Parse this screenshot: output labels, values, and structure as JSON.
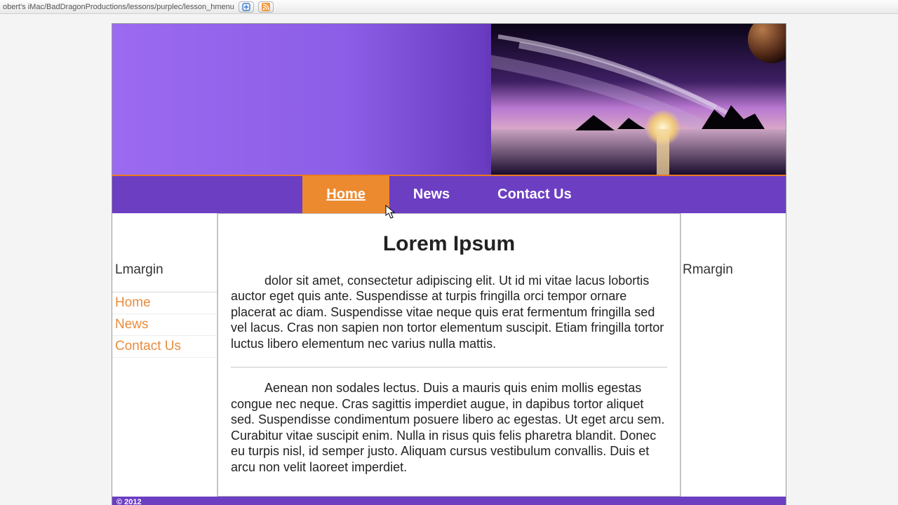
{
  "browser": {
    "path": "obert's iMac/BadDragonProductions/lessons/purplec/lesson_hmenu"
  },
  "nav": {
    "items": [
      {
        "label": "Home",
        "active": true
      },
      {
        "label": "News",
        "active": false
      },
      {
        "label": "Contact Us",
        "active": false
      }
    ]
  },
  "left": {
    "label": "Lmargin",
    "links": [
      "Home",
      "News",
      "Contact Us"
    ]
  },
  "right": {
    "label": "Rmargin"
  },
  "article": {
    "title": "Lorem Ipsum",
    "p1": "dolor sit amet, consectetur adipiscing elit. Ut id mi vitae lacus lobortis auctor eget quis ante. Suspendisse at turpis fringilla orci tempor ornare placerat ac diam. Suspendisse vitae neque quis erat fermentum fringilla sed vel lacus. Cras non sapien non tortor elementum suscipit. Etiam fringilla tortor luctus libero elementum nec varius nulla mattis.",
    "p2": "Aenean non sodales lectus. Duis a mauris quis enim mollis egestas congue nec neque. Cras sagittis imperdiet augue, in dapibus tortor aliquet sed. Suspendisse condimentum posuere libero ac egestas. Ut eget arcu sem. Curabitur vitae suscipit enim. Nulla in risus quis felis pharetra blandit. Donec eu turpis nisl, id semper justo. Aliquam cursus vestibulum convallis. Duis et arcu non velit laoreet imperdiet."
  },
  "footer": {
    "copyright": "© 2012"
  }
}
